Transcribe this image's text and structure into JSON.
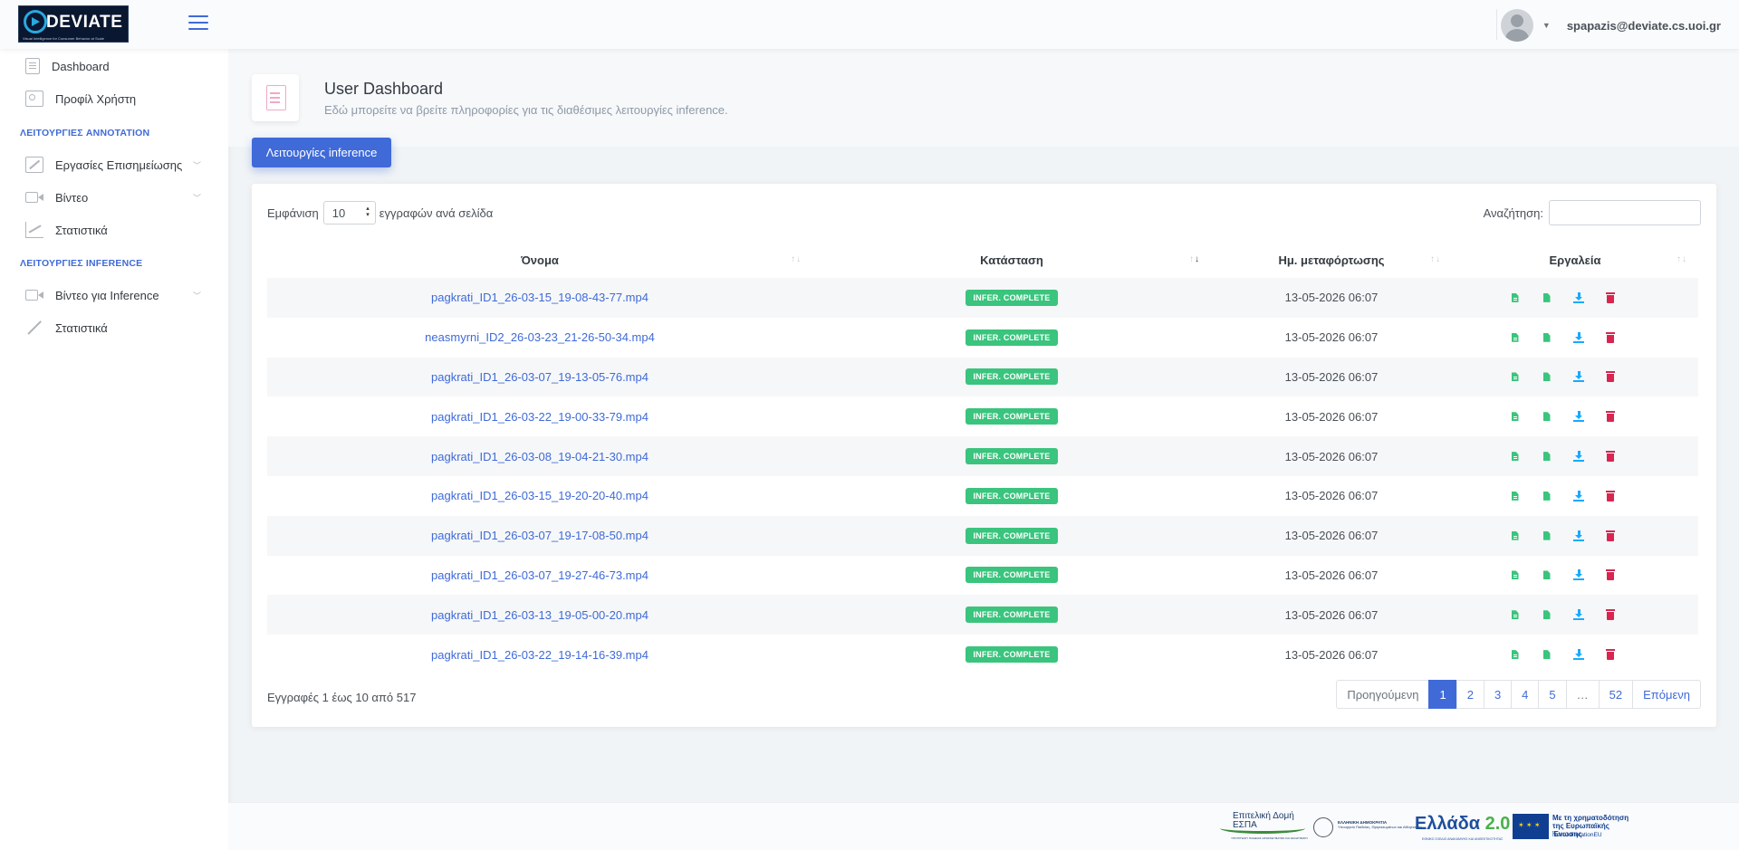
{
  "header": {
    "logo_text": "DEVIATE",
    "logo_tagline": "Visual Intelligence for Consumer Behavior at Scale",
    "user_email": "spapazis@deviate.cs.uoi.gr"
  },
  "sidebar": {
    "items_top": [
      {
        "label": "Dashboard",
        "icon": "document-icon"
      },
      {
        "label": "Προφίλ Χρήστη",
        "icon": "id-card-icon"
      }
    ],
    "section1_title": "ΛΕΙΤΟΥΡΓΙΕΣ ANNOTATION",
    "section1_items": [
      {
        "label": "Εργασίες Επισημείωσης",
        "icon": "edit-icon"
      },
      {
        "label": "Βίντεο",
        "icon": "video-camera-icon"
      },
      {
        "label": "Στατιστικά",
        "icon": "chart-icon"
      }
    ],
    "section2_title": "ΛΕΙΤΟΥΡΓΙΕΣ INFERENCE",
    "section2_items": [
      {
        "label": "Βίντεο για Inference",
        "icon": "video-camera-icon"
      },
      {
        "label": "Στατιστικά",
        "icon": "trend-icon"
      }
    ]
  },
  "page": {
    "title": "User Dashboard",
    "subtitle": "Εδώ μπορείτε να βρείτε πληροφορίες για τις διαθέσιμες λειτουργίες inference.",
    "tab_label": "Λειτουργίες inference"
  },
  "table": {
    "show_label": "Εμφάνιση",
    "page_size": "10",
    "per_page_label": "εγγραφών ανά σελίδα",
    "search_label": "Αναζήτηση:",
    "search_value": "",
    "columns": [
      "Όνομα",
      "Κατάσταση",
      "Ημ. μεταφόρτωσης",
      "Εργαλεία"
    ],
    "rows": [
      {
        "name": "pagkrati_ID1_26-03-15_19-08-43-77.mp4",
        "status": "INFER. COMPLETE",
        "date": "13-05-2026 06:07"
      },
      {
        "name": "neasmyrni_ID2_26-03-23_21-26-50-34.mp4",
        "status": "INFER. COMPLETE",
        "date": "13-05-2026 06:07"
      },
      {
        "name": "pagkrati_ID1_26-03-07_19-13-05-76.mp4",
        "status": "INFER. COMPLETE",
        "date": "13-05-2026 06:07"
      },
      {
        "name": "pagkrati_ID1_26-03-22_19-00-33-79.mp4",
        "status": "INFER. COMPLETE",
        "date": "13-05-2026 06:07"
      },
      {
        "name": "pagkrati_ID1_26-03-08_19-04-21-30.mp4",
        "status": "INFER. COMPLETE",
        "date": "13-05-2026 06:07"
      },
      {
        "name": "pagkrati_ID1_26-03-15_19-20-20-40.mp4",
        "status": "INFER. COMPLETE",
        "date": "13-05-2026 06:07"
      },
      {
        "name": "pagkrati_ID1_26-03-07_19-17-08-50.mp4",
        "status": "INFER. COMPLETE",
        "date": "13-05-2026 06:07"
      },
      {
        "name": "pagkrati_ID1_26-03-07_19-27-46-73.mp4",
        "status": "INFER. COMPLETE",
        "date": "13-05-2026 06:07"
      },
      {
        "name": "pagkrati_ID1_26-03-13_19-05-00-20.mp4",
        "status": "INFER. COMPLETE",
        "date": "13-05-2026 06:07"
      },
      {
        "name": "pagkrati_ID1_26-03-22_19-14-16-39.mp4",
        "status": "INFER. COMPLETE",
        "date": "13-05-2026 06:07"
      }
    ],
    "tool_icons": [
      "file-text-icon",
      "file-icon",
      "download-icon",
      "trash-icon"
    ],
    "info": "Εγγραφές 1 έως 10 από 517",
    "pagination": {
      "prev": "Προηγούμενη",
      "pages": [
        "1",
        "2",
        "3",
        "4",
        "5",
        "…",
        "52"
      ],
      "active": "1",
      "next": "Επόμενη"
    }
  },
  "footer": {
    "espa_title": "Επιτελική Δομή ΕΣΠΑ",
    "espa_sub": "ΥΠΟΥΡΓΕΙΟΥ ΠΑΙΔΕΙΑΣ ΘΡΗΣΚΕΥΜΑΤΩΝ ΚΑΙ ΑΘΛΗΤΙΣΜΟΥ",
    "gr_title": "ΕΛΛΗΝΙΚΗ ΔΗΜΟΚΡΑΤΙΑ",
    "gr_sub": "Υπουργείο Παιδείας, Θρησκευμάτων και Αθλητισμού",
    "greece20_text": "Ελλάδα",
    "greece20_num": "2.0",
    "greece20_sub": "ΕΘΝΙΚΟ ΣΧΕΔΙΟ ΑΝΑΚΑΜΨΗΣ ΚΑΙ ΑΝΘΕΚΤΙΚΟΤΗΤΑΣ",
    "eu_title": "Με τη χρηματοδότηση της Ευρωπαϊκής Ένωσης",
    "eu_sub": "NextGenerationEU"
  },
  "colors": {
    "primary": "#3f6ad8",
    "success": "#3ac47d",
    "info": "#16aaff",
    "danger": "#d92550"
  }
}
